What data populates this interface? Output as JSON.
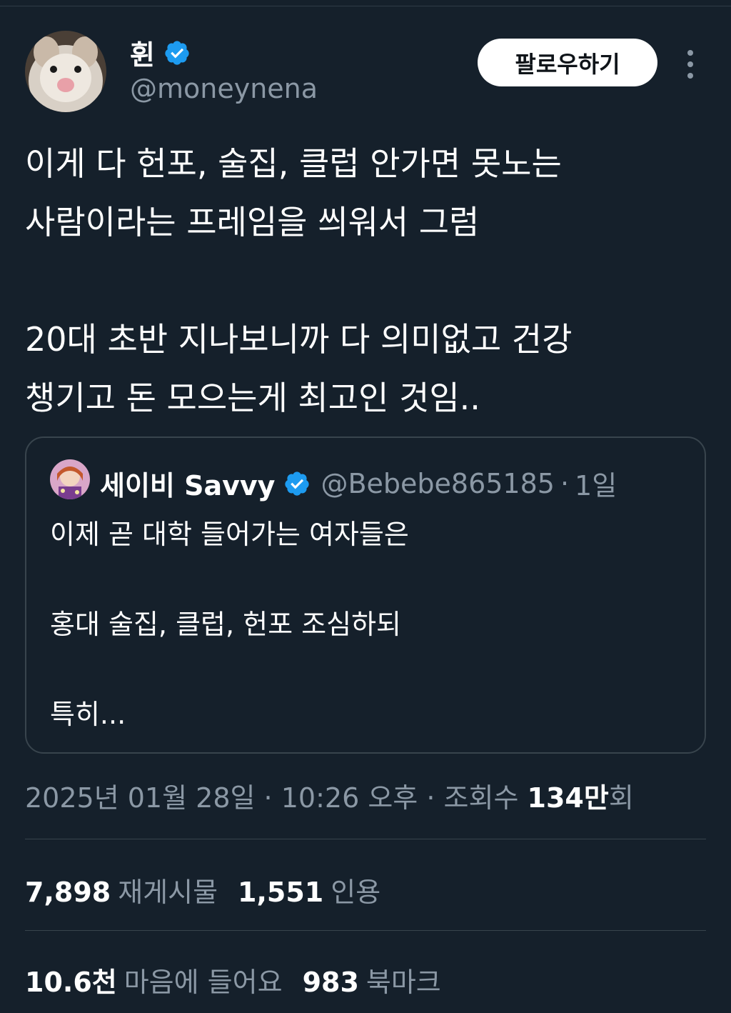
{
  "author": {
    "name": "휜",
    "handle": "@moneynena",
    "verified_color": "#1d9bf0"
  },
  "actions": {
    "follow_label": "팔로우하기",
    "more_icon": "more-vertical-icon"
  },
  "tweet": {
    "text": "이게 다 헌포, 술집, 클럽 안가면 못노는\n사람이라는 프레임을 씌워서 그럼\n\n20대 초반 지나보니까 다 의미없고 건강\n챙기고 돈 모으는게 최고인 것임.."
  },
  "quote": {
    "name": "세이비 Savvy",
    "handle": "@Bebebe865185",
    "separator": "·",
    "time": "1일",
    "text": "이제 곧 대학 들어가는 여자들은\n\n홍대 술집, 클럽, 헌포 조심하되\n\n특히..."
  },
  "meta": {
    "date": "2025년 01월 28일",
    "sep1": "·",
    "time": "10:26 오후",
    "sep2": "·",
    "views_label_prefix": "조회수",
    "views_value": "134만",
    "views_suffix": "회"
  },
  "stats": {
    "reposts": "7,898",
    "reposts_label": "재게시물",
    "quotes": "1,551",
    "quotes_label": "인용",
    "likes": "10.6천",
    "likes_label": "마음에 들어요",
    "bookmarks": "983",
    "bookmarks_label": "북마크"
  },
  "colors": {
    "background": "#15202b",
    "secondary_text": "#8b98a5",
    "border": "#38444d"
  }
}
